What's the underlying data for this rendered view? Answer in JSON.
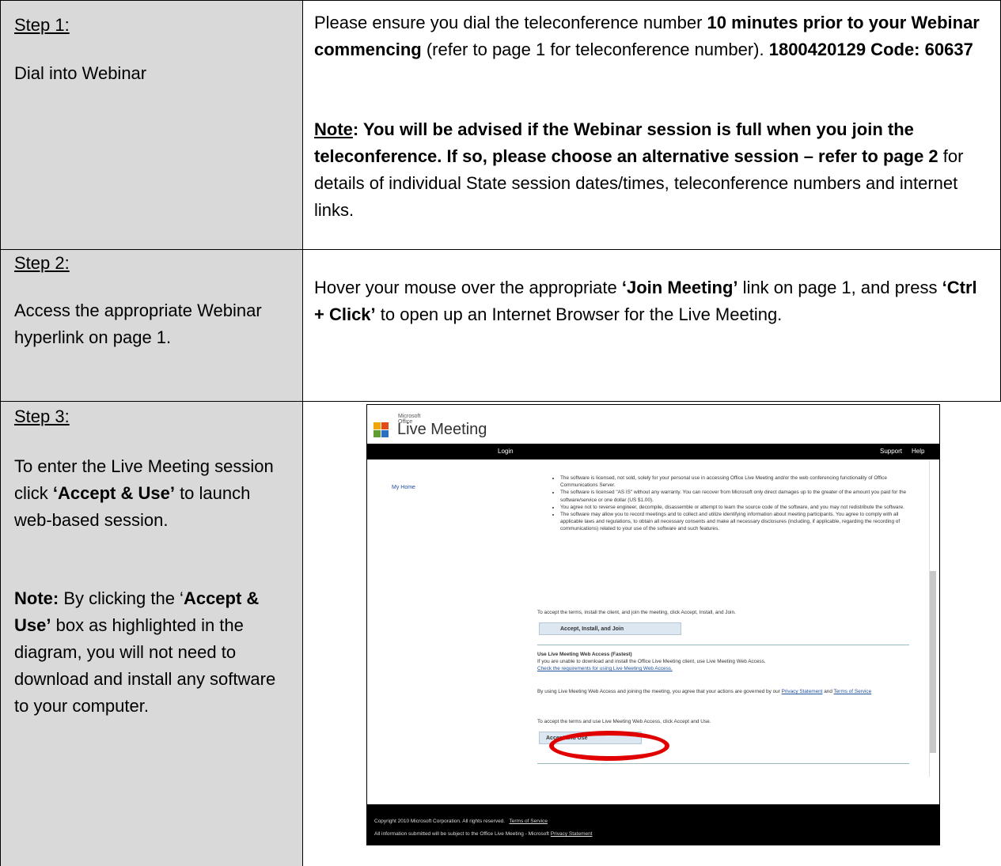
{
  "rows": [
    {
      "step_label": "Step 1:",
      "step_desc": "Dial into Webinar",
      "content": {
        "p1_a": "Please ensure you dial the teleconference number ",
        "p1_b": "10 minutes prior to your Webinar commencing",
        "p1_c": " (refer to page 1 for teleconference number). ",
        "p1_d": "1800420129 Code: 60637",
        "note_label": "Note",
        "note_a": ": You will be advised if the Webinar session is full when you join the teleconference. If so, please choose an alternative session – refer to page 2",
        "note_b": " for details of individual State session dates/times, teleconference numbers and internet links."
      }
    },
    {
      "step_label": "Step 2:",
      "step_desc": "Access the appropriate Webinar hyperlink on page 1.",
      "content": {
        "a": "Hover your mouse over the appropriate ",
        "b": "‘Join Meeting’",
        "c": " link on page 1, and press ",
        "d": "‘Ctrl + Click’",
        "e": " to open up an Internet Browser for the Live Meeting."
      }
    },
    {
      "step_label": "Step 3:",
      "step_desc_a": "To enter the Live Meeting session click ",
      "step_desc_b": "‘Accept & Use’",
      "step_desc_c": " to launch web-based session.",
      "note_label": "Note:",
      "note_a": " By clicking the ‘",
      "note_b": "Accept & Use’",
      "note_c": " box as highlighted in the diagram, you will not need to download and install any software to your computer."
    }
  ],
  "screenshot": {
    "brand_small": "Microsoft Office",
    "brand": "Live Meeting",
    "nav_login": "Login",
    "nav_support": "Support",
    "nav_help": "Help",
    "side_link": "My Home",
    "bullets": [
      "The software is licensed, not sold, solely for your personal use in accessing Office Live Meeting and/or the web conferencing functionality of Office Communications Server.",
      "The software is licensed \"AS IS\" without any warranty. You can recover from Microsoft only direct damages up to the greater of the amount you paid for the software/service or one dollar (US $1.00).",
      "You agree not to reverse engineer, decompile, disassemble or attempt to learn the source code of the software, and you may not redistribute the software.",
      "The software may allow you to record meetings and to collect and utilize identifying information about meeting participants. You agree to comply with all applicable laws and regulations, to obtain all necessary consents and make all necessary disclosures (including, if applicable, regarding the recording of communications) related to your use of the software and such features."
    ],
    "install_text": "To accept the terms, install the client, and join the meeting, click Accept, Install, and Join.",
    "install_button": "Accept, Install, and Join",
    "web_heading": "Use Live Meeting Web Access (Fastest)",
    "web_text": "If you are unable to download and install the Office Live Meeting client, use Live Meeting Web Access.",
    "web_link": "Check the requirements for using Live Meeting Web Access.",
    "agree_text_a": "By using Live Meeting Web Access and joining the meeting, you agree that your actions are governed by our ",
    "agree_privacy": "Privacy Statement",
    "agree_and": " and ",
    "agree_terms": "Terms of Service",
    "accept_text": "To accept the terms and use Live Meeting Web Access, click Accept and Use.",
    "accept_button": "Accept and Use",
    "footer_1": "Copyright 2010 Microsoft Corporation. All rights reserved.",
    "footer_1_link": "Terms of Service",
    "footer_2": "All information submitted will be subject to the Office Live Meeting - Microsoft",
    "footer_2_link": "Privacy Statement"
  }
}
